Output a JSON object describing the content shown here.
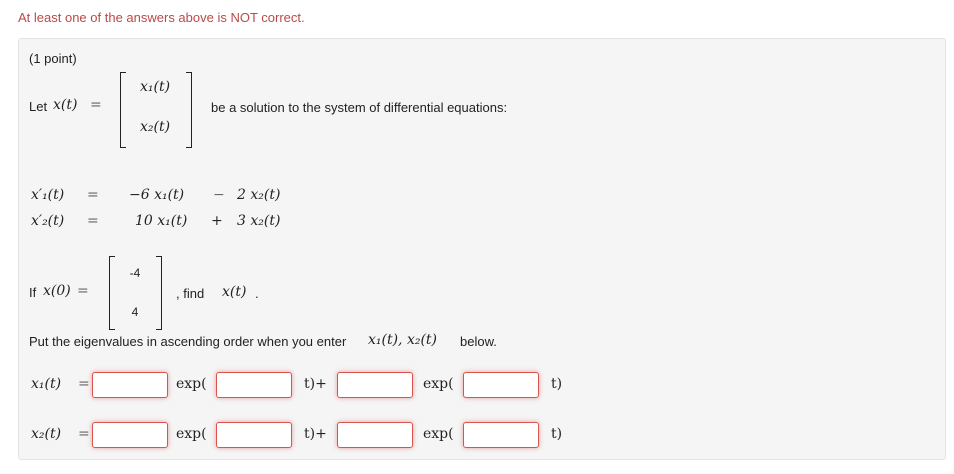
{
  "warning": "At least one of the answers above is NOT correct.",
  "points": "(1 point)",
  "intro": {
    "let": "Let",
    "x_of_t": "x(t)",
    "equals": "=",
    "vec_top": "x₁(t)",
    "vec_bottom": "x₂(t)",
    "after": "be a solution to the system of differential equations:"
  },
  "system": [
    {
      "lhs": "x′₁(t)",
      "eq": "=",
      "a": "−6 x₁(t)",
      "op": "−",
      "b": "2 x₂(t)"
    },
    {
      "lhs": "x′₂(t)",
      "eq": "=",
      "a": "10 x₁(t)",
      "op": "+",
      "b": "3 x₂(t)"
    }
  ],
  "initial": {
    "if": "If",
    "x0": "x(0)",
    "equals": "=",
    "top": "-4",
    "bottom": "4",
    "after_comma": ", find",
    "x_of_t": "x(t)",
    "period": "."
  },
  "instruction": {
    "text": "Put the eigenvalues in ascending order when you enter",
    "vars": "x₁(t), x₂(t)",
    "below": "below."
  },
  "answer_rows": [
    {
      "label": "x₁(t)",
      "equals": "=",
      "exp1": "exp(",
      "t_plus": "t)+",
      "exp2": "exp(",
      "t_close": "t)"
    },
    {
      "label": "x₂(t)",
      "equals": "=",
      "exp1": "exp(",
      "t_plus": "t)+",
      "exp2": "exp(",
      "t_close": "t)"
    }
  ],
  "inputs": {
    "x1": [
      "",
      "",
      "",
      ""
    ],
    "x2": [
      "",
      "",
      "",
      ""
    ]
  },
  "colors": {
    "warning": "#b94a48",
    "panel_bg": "#f5f5f5",
    "error_border": "#d9534f"
  }
}
